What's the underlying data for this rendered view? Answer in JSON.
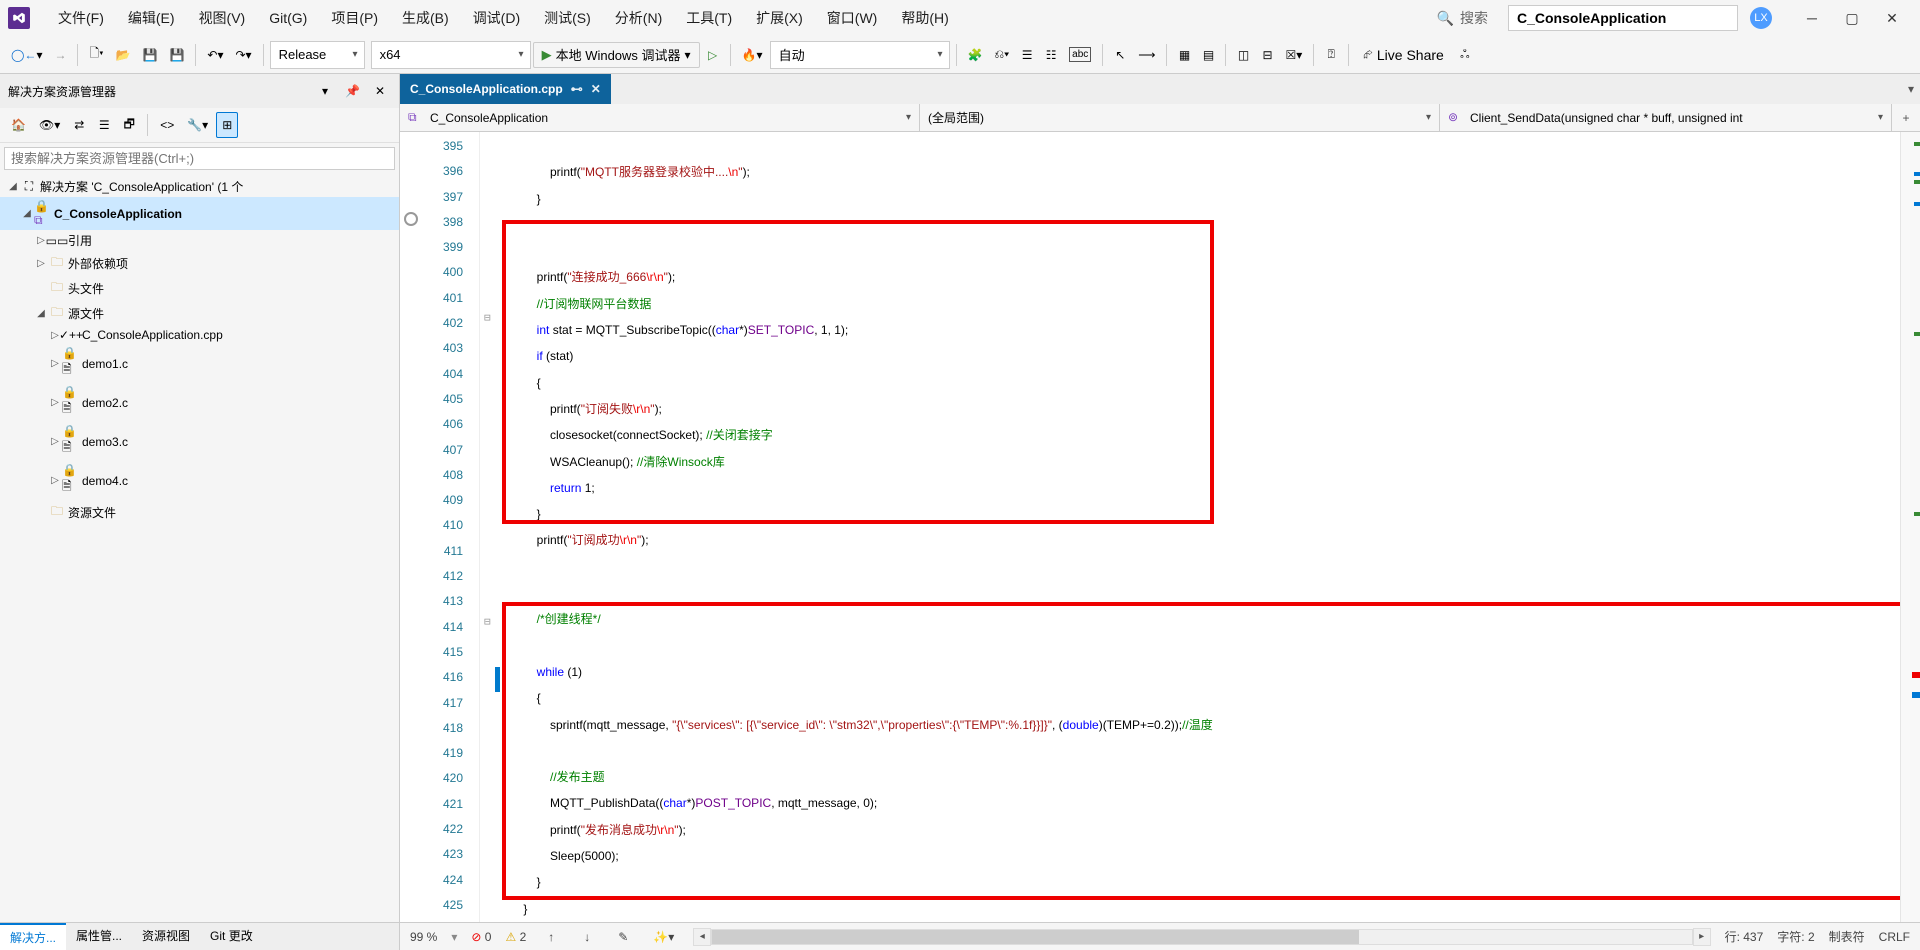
{
  "menu": [
    "文件(F)",
    "编辑(E)",
    "视图(V)",
    "Git(G)",
    "项目(P)",
    "生成(B)",
    "调试(D)",
    "测试(S)",
    "分析(N)",
    "工具(T)",
    "扩展(X)",
    "窗口(W)",
    "帮助(H)"
  ],
  "search": {
    "icon": "🔍",
    "label": "搜索"
  },
  "title_combo": "C_ConsoleApplication",
  "initials": "LX",
  "toolbar": {
    "config": "Release",
    "platform": "x64",
    "debugger": "本地 Windows 调试器",
    "auto": "自动",
    "live_share": "Live Share"
  },
  "panel": {
    "title": "解决方案资源管理器",
    "search_ph": "搜索解决方案资源管理器(Ctrl+;)",
    "solution": "解决方案 'C_ConsoleApplication' (1 个",
    "project": "C_ConsoleApplication",
    "refs": "引用",
    "external": "外部依赖项",
    "headers": "头文件",
    "sources": "源文件",
    "files": [
      "C_ConsoleApplication.cpp",
      "demo1.c",
      "demo2.c",
      "demo3.c",
      "demo4.c"
    ],
    "resources": "资源文件",
    "tabs": [
      "解决方...",
      "属性管...",
      "资源视图",
      "Git 更改"
    ]
  },
  "tabs": {
    "doc": "C_ConsoleApplication.cpp"
  },
  "nav": {
    "scope": "C_ConsoleApplication",
    "middle": "(全局范围)",
    "func": "Client_SendData(unsigned char * buff, unsigned int "
  },
  "code": {
    "lines": [
      395,
      396,
      397,
      398,
      399,
      400,
      401,
      402,
      403,
      404,
      405,
      406,
      407,
      408,
      409,
      410,
      411,
      412,
      413,
      414,
      415,
      416,
      417,
      418,
      419,
      420,
      421,
      422,
      423,
      424,
      425
    ]
  },
  "status": {
    "zoom": "99 %",
    "err_n": "0",
    "warn_n": "2",
    "line": "行: 437",
    "col": "字符: 2",
    "tabs": "制表符",
    "crlf": "CRLF"
  }
}
